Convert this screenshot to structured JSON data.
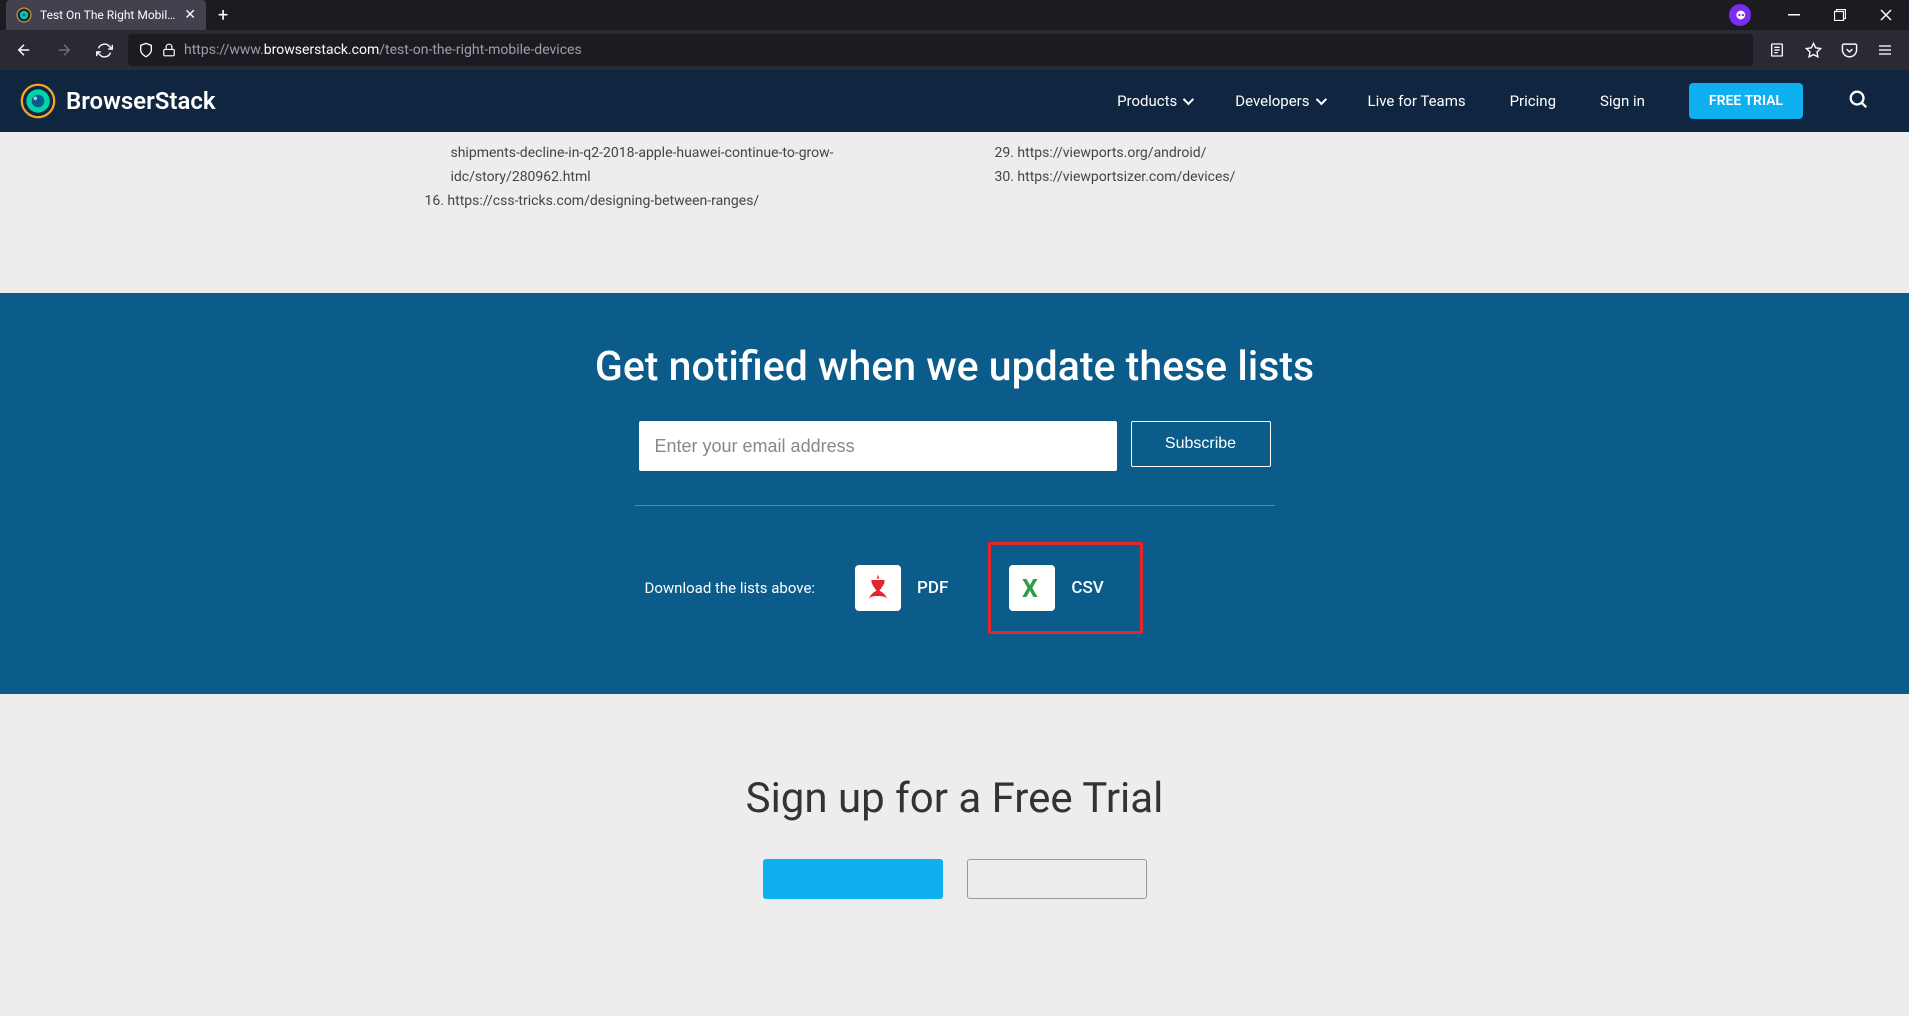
{
  "browser": {
    "tab_title": "Test On The Right Mobile Devic",
    "url_prefix": "https://www.",
    "url_domain": "browserstack.com",
    "url_path": "/test-on-the-right-mobile-devices"
  },
  "header": {
    "brand": "BrowserStack",
    "nav": {
      "products": "Products",
      "developers": "Developers",
      "live": "Live for Teams",
      "pricing": "Pricing",
      "signin": "Sign in",
      "free_trial": "FREE TRIAL"
    }
  },
  "refs": {
    "left": [
      "shipments-decline-in-q2-2018-apple-huawei-continue-to-grow-idc/story/280962.html",
      "16. https://css-tricks.com/designing-between-ranges/"
    ],
    "right": [
      "29. https://viewports.org/android/",
      "30. https://viewportsizer.com/devices/"
    ]
  },
  "notify": {
    "title": "Get notified when we update these lists",
    "email_placeholder": "Enter your email address",
    "subscribe": "Subscribe",
    "download_label": "Download the lists above:",
    "pdf": "PDF",
    "csv": "CSV"
  },
  "signup": {
    "title": "Sign up for a Free Trial"
  }
}
